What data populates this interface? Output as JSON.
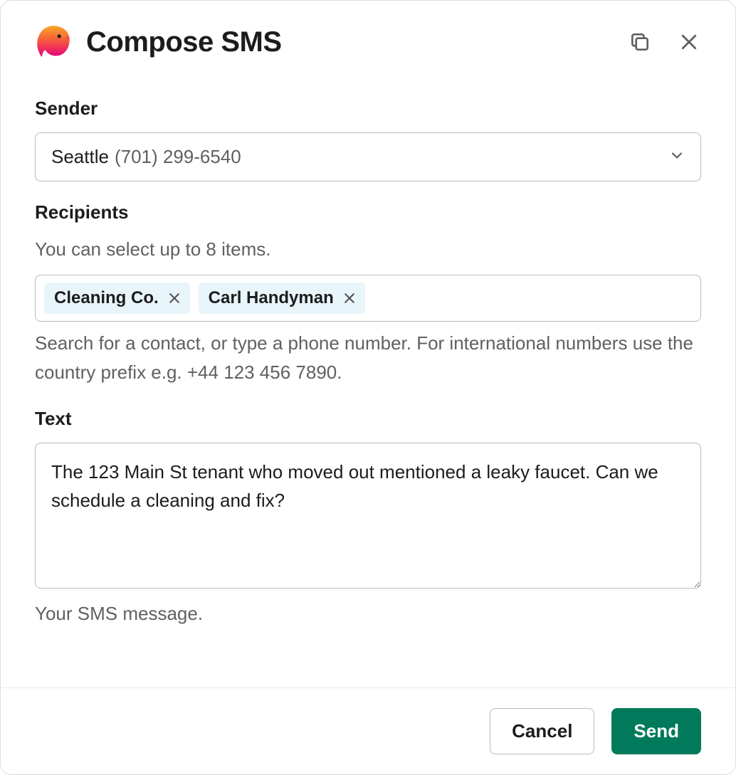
{
  "header": {
    "title": "Compose SMS"
  },
  "sender": {
    "label": "Sender",
    "selected_name": "Seattle",
    "selected_number": "(701) 299-6540"
  },
  "recipients": {
    "label": "Recipients",
    "limit_hint": "You can select up to 8 items.",
    "chips": [
      {
        "label": "Cleaning Co."
      },
      {
        "label": "Carl Handyman"
      }
    ],
    "help": "Search for a contact, or type a phone number. For international numbers use the country prefix e.g. +44 123 456 7890."
  },
  "text": {
    "label": "Text",
    "value": "The 123 Main St tenant who moved out mentioned a leaky faucet. Can we schedule a cleaning and fix?",
    "help": "Your SMS message."
  },
  "footer": {
    "cancel": "Cancel",
    "send": "Send"
  }
}
